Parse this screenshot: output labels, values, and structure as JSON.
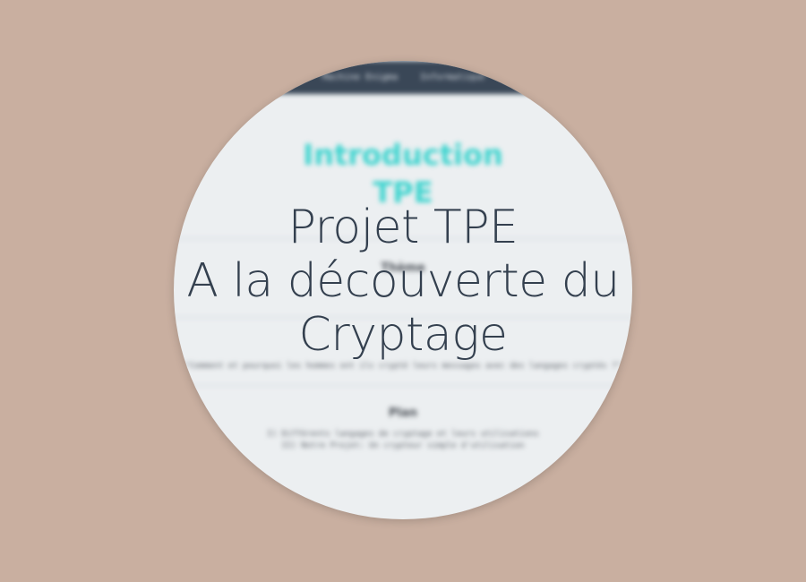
{
  "background_color": "#c9afa0",
  "preview": {
    "navbar": {
      "items": [
        "Machine Enigma",
        "Informatique"
      ]
    },
    "intro_title": [
      "Introduction",
      "TPE"
    ],
    "sections": [
      {
        "heading": "Thème",
        "lines": [
          "",
          ""
        ]
      },
      {
        "heading": "",
        "lines": [
          "\"Comment et pourquoi les hommes ont ils crypté leurs messages avec des langages cryptés ?\""
        ]
      },
      {
        "heading": "Plan",
        "lines": [
          "I) Différents langages de cryptage et leurs utilisations",
          "II) Notre Projet: Un crypteur simple d'utilisation"
        ]
      }
    ],
    "accent_color": "#3fd4cf"
  },
  "hero": {
    "lines": [
      "Projet TPE",
      "A la découverte du",
      "Cryptage"
    ],
    "color": "#34404f"
  }
}
